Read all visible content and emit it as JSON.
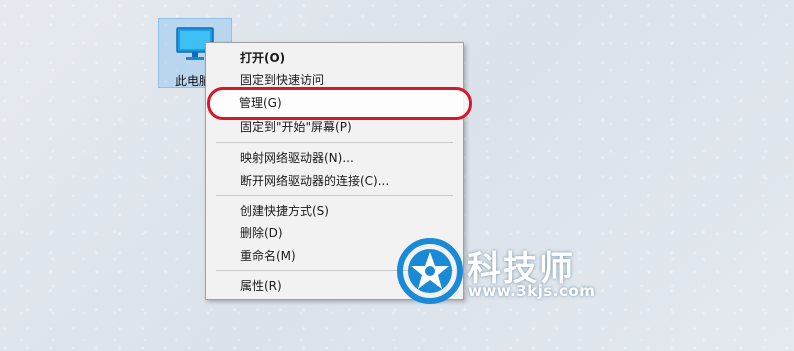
{
  "desktop": {
    "icon_label": "此电脑",
    "icon_name": "this-pc-monitor-icon"
  },
  "context_menu": {
    "items": [
      {
        "label": "打开(O)",
        "bold": true
      },
      {
        "label": "固定到快速访问"
      },
      {
        "label": "管理(G)",
        "highlighted": true
      },
      {
        "label": "固定到\"开始\"屏幕(P)"
      },
      {
        "label": "映射网络驱动器(N)..."
      },
      {
        "label": "断开网络驱动器的连接(C)..."
      },
      {
        "label": "创建快捷方式(S)"
      },
      {
        "label": "删除(D)"
      },
      {
        "label": "重命名(M)"
      },
      {
        "label": "属性(R)"
      }
    ]
  },
  "annotation": {
    "color": "#d7172b",
    "target": "管理(G)"
  },
  "watermark": {
    "brand": "科技师",
    "site": "www.3kjs.com",
    "logo_color": "#1a8ad6"
  }
}
